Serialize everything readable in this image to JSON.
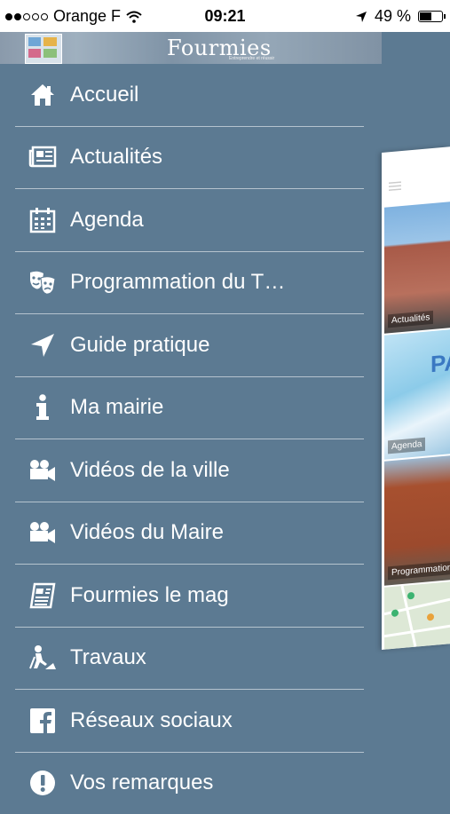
{
  "status_bar": {
    "carrier": "Orange F",
    "time": "09:21",
    "battery": "49 %",
    "battery_level": 0.49
  },
  "header": {
    "logo": "Fourmies",
    "tagline": "Entreprendre et réussir"
  },
  "menu": {
    "items": [
      {
        "label": "Accueil",
        "icon": "home-icon"
      },
      {
        "label": "Actualités",
        "icon": "newspaper-icon"
      },
      {
        "label": "Agenda",
        "icon": "calendar-icon"
      },
      {
        "label": "Programmation du T…",
        "icon": "theater-masks-icon"
      },
      {
        "label": "Guide pratique",
        "icon": "location-arrow-icon"
      },
      {
        "label": "Ma mairie",
        "icon": "info-icon"
      },
      {
        "label": "Vidéos de la ville",
        "icon": "video-camera-icon"
      },
      {
        "label": "Vidéos du Maire",
        "icon": "video-camera-icon"
      },
      {
        "label": "Fourmies le mag",
        "icon": "magazine-icon"
      },
      {
        "label": "Travaux",
        "icon": "roadwork-icon"
      },
      {
        "label": "Réseaux sociaux",
        "icon": "facebook-icon"
      },
      {
        "label": "Vos remarques",
        "icon": "exclamation-icon"
      }
    ]
  },
  "preview": {
    "tiles": [
      {
        "caption": "Actualités"
      },
      {
        "caption": "Agenda"
      },
      {
        "caption": "Programmation"
      }
    ]
  },
  "colors": {
    "menu_background": "#5c7a92",
    "divider": "#c7d2db",
    "text": "#ffffff"
  }
}
